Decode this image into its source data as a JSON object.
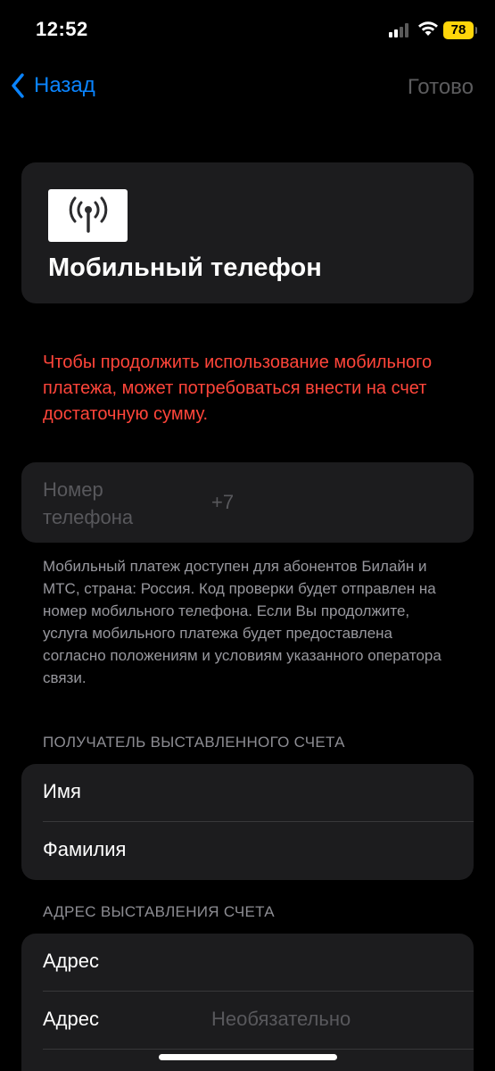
{
  "status_bar": {
    "time": "12:52",
    "battery": "78",
    "battery_color": "#ffd60a"
  },
  "nav": {
    "back_label": "Назад",
    "done_label": "Готово",
    "accent": "#0a84ff"
  },
  "header": {
    "icon": "cellular-antenna-icon",
    "title": "Мобильный телефон"
  },
  "warning_text": "Чтобы продолжить использование мобильного платежа, может потребоваться внести на счет достаточную сумму.",
  "warning_color": "#ff453a",
  "phone": {
    "label": "Номер телефона",
    "prefix": "+7"
  },
  "info_text": "Мобильный платеж доступен для абонентов Билайн и МТС, страна: Россия. Код проверки будет отправлен на номер мобильного телефона. Если Вы продолжите, услуга мобильного платежа будет предоставлена согласно положениям и условиям указанного оператора связи.",
  "recipient": {
    "header": "ПОЛУЧАТЕЛЬ ВЫСТАВЛЕННОГО СЧЕТА",
    "first_name_label": "Имя",
    "last_name_label": "Фамилия"
  },
  "address": {
    "header": "АДРЕС ВЫСТАВЛЕНИЯ СЧЕТА",
    "line1_label": "Адрес",
    "line2_label": "Адрес",
    "line2_placeholder": "Необязательно"
  }
}
